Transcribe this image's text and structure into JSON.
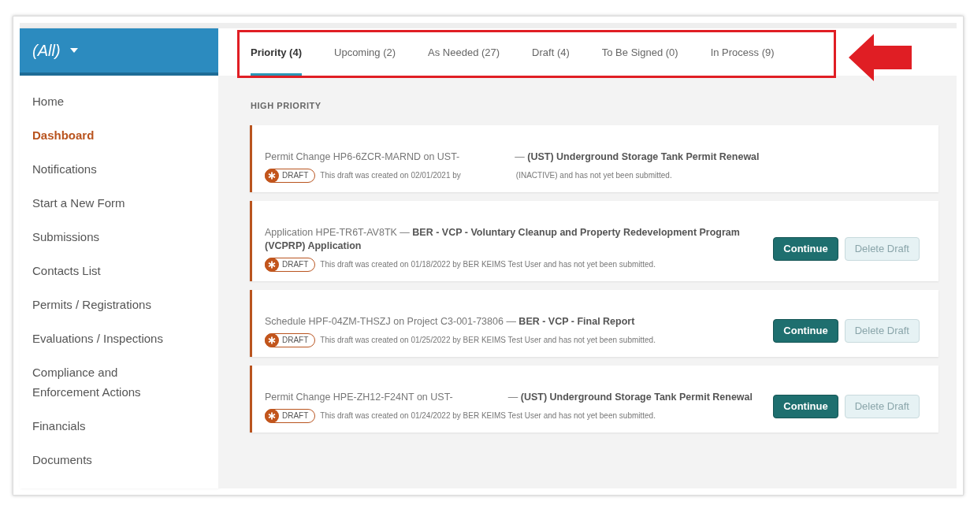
{
  "scope": {
    "label": "(All)"
  },
  "sidebar": {
    "items": [
      {
        "label": "Home",
        "selected": false
      },
      {
        "label": "Dashboard",
        "selected": true
      },
      {
        "label": "Notifications",
        "selected": false
      },
      {
        "label": "Start a New Form",
        "selected": false
      },
      {
        "label": "Submissions",
        "selected": false
      },
      {
        "label": "Contacts List",
        "selected": false
      },
      {
        "label": "Permits / Registrations",
        "selected": false
      },
      {
        "label": "Evaluations / Inspections",
        "selected": false
      },
      {
        "label": "Compliance and Enforcement Actions",
        "selected": false
      },
      {
        "label": "Financials",
        "selected": false
      },
      {
        "label": "Documents",
        "selected": false
      }
    ]
  },
  "tabs": [
    {
      "label": "Priority (4)",
      "selected": true
    },
    {
      "label": "Upcoming (2)",
      "selected": false
    },
    {
      "label": "As Needed (27)",
      "selected": false
    },
    {
      "label": "Draft (4)",
      "selected": false
    },
    {
      "label": "To Be Signed (0)",
      "selected": false
    },
    {
      "label": "In Process (9)",
      "selected": false
    }
  ],
  "section_title": "HIGH PRIORITY",
  "cards": [
    {
      "title": [
        "Permit Change HP6-6ZCR-MARND on UST-",
        "— **(UST) Underground Storage Tank Permit Renewal**"
      ],
      "badge": "DRAFT",
      "note": [
        "This draft was created on 02/01/2021 by",
        "(INACTIVE) and has not yet been submitted."
      ]
    },
    {
      "title": [
        "Application HPE-TR6T-AV8TK — **BER - VCP - Voluntary Cleanup and Property Redevelopment Program (VCPRP) Application**"
      ],
      "badge": "DRAFT",
      "note": [
        "This draft was created on 01/18/2022 by BER KEIMS Test User and has not yet been submitted."
      ],
      "buttons": [
        {
          "label": "Continue",
          "kind": "primary"
        },
        {
          "label": "Delete Draft",
          "kind": "secondary"
        }
      ]
    },
    {
      "title": [
        "Schedule HPF-04ZM-THSZJ on Project C3-001-73806 — **BER - VCP - Final Report**"
      ],
      "badge": "DRAFT",
      "note": [
        "This draft was created on 01/25/2022 by BER KEIMS Test User and has not yet been submitted."
      ],
      "buttons": [
        {
          "label": "Continue",
          "kind": "primary"
        },
        {
          "label": "Delete Draft",
          "kind": "secondary"
        }
      ]
    },
    {
      "title": [
        "Permit Change HPE-ZH12-F24NT on UST-",
        "— **(UST) Underground Storage Tank Permit Renewal**"
      ],
      "badge": "DRAFT",
      "note": [
        "This draft was created on 01/24/2022 by BER KEIMS Test User and has not yet been submitted."
      ],
      "buttons": [
        {
          "label": "Continue",
          "kind": "primary"
        },
        {
          "label": "Delete Draft",
          "kind": "secondary"
        }
      ]
    }
  ]
}
